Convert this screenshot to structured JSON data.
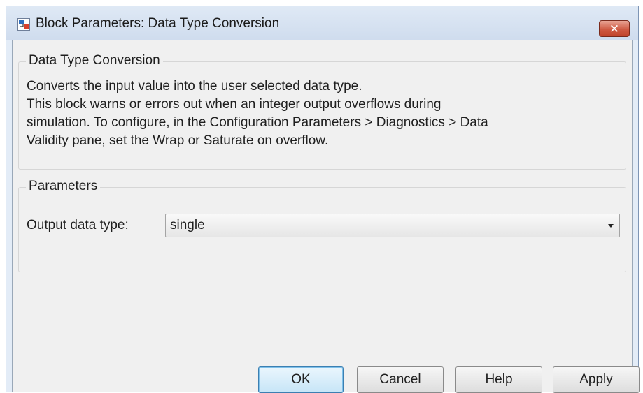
{
  "window": {
    "title": "Block Parameters: Data Type Conversion",
    "close_symbol": "✕"
  },
  "description_group": {
    "legend": "Data Type Conversion",
    "lines": [
      "Converts the input value into the user selected data type.",
      "This block warns or errors out when an integer output overflows during",
      "simulation. To configure, in the Configuration Parameters > Diagnostics > Data",
      "Validity pane, set the Wrap or Saturate on overflow."
    ]
  },
  "parameters_group": {
    "legend": "Parameters",
    "output_data_type": {
      "label": "Output data type:",
      "value": "single"
    }
  },
  "buttons": {
    "ok": "OK",
    "cancel": "Cancel",
    "help": "Help",
    "apply": "Apply"
  },
  "icons": {
    "app": "simulink-block-icon",
    "close": "close-icon",
    "dropdown": "chevron-down-icon"
  },
  "colors": {
    "close_button": "#cf5a43",
    "default_button_border": "#3c7fb1",
    "dialog_background": "#f0f0f0",
    "titlebar": "#dfe9f5"
  }
}
